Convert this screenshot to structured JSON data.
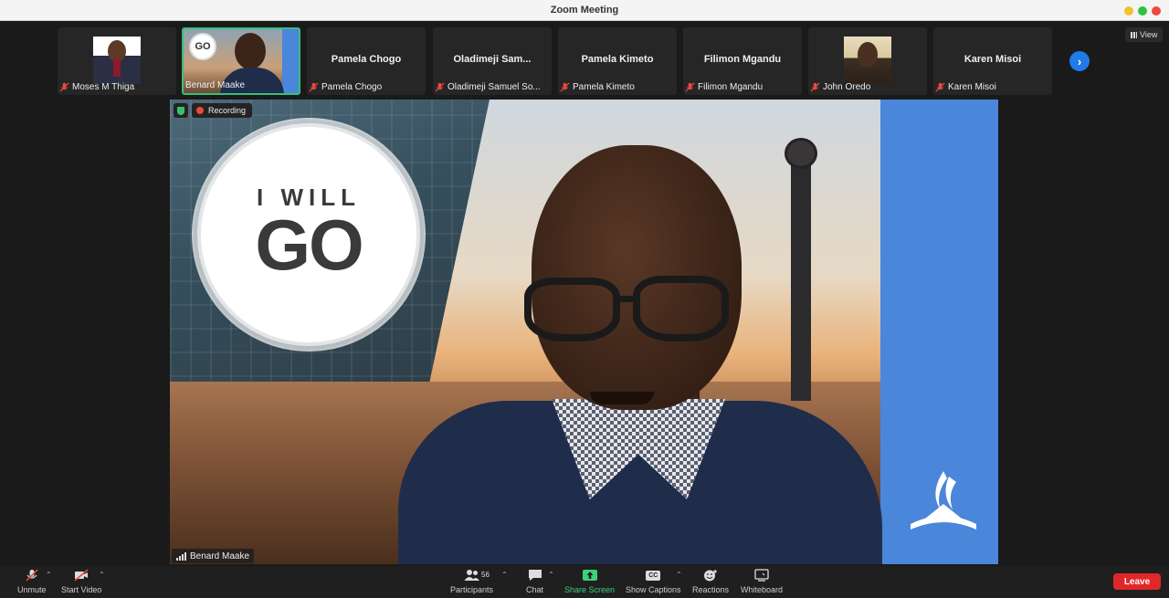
{
  "window": {
    "title": "Zoom Meeting"
  },
  "view_button": {
    "label": "View"
  },
  "thumbnails": [
    {
      "name": "Moses M Thiga",
      "bigname": "",
      "muted": true,
      "photo": "moses"
    },
    {
      "name": "Benard Maake",
      "bigname": "",
      "muted": false,
      "photo": "benard"
    },
    {
      "name": "Pamela Chogo",
      "bigname": "Pamela Chogo",
      "muted": true
    },
    {
      "name": "Oladimeji Samuel So...",
      "bigname": "Oladimeji Sam...",
      "muted": true
    },
    {
      "name": "Pamela Kimeto",
      "bigname": "Pamela Kimeto",
      "muted": true
    },
    {
      "name": "Filimon Mgandu",
      "bigname": "Filimon Mgandu",
      "muted": true
    },
    {
      "name": "John Oredo",
      "bigname": "",
      "muted": true,
      "photo": "john"
    },
    {
      "name": "Karen Misoi",
      "bigname": "Karen Misoi",
      "muted": true
    }
  ],
  "speaker": {
    "name": "Benard Maake",
    "recording_label": "Recording",
    "logo_line1": "I WILL",
    "logo_line2": "GO"
  },
  "toolbar": {
    "unmute": "Unmute",
    "start_video": "Start Video",
    "participants": "Participants",
    "participants_count": "56",
    "chat": "Chat",
    "share_screen": "Share Screen",
    "show_captions": "Show Captions",
    "captions_icon_text": "CC",
    "reactions": "Reactions",
    "whiteboard": "Whiteboard",
    "leave": "Leave"
  },
  "colors": {
    "accent": "#1f7be8",
    "share_green": "#3bd17a",
    "leave_red": "#e02828",
    "active_speaker_border": "#36c07a",
    "recording_dot": "#e84a3d"
  }
}
